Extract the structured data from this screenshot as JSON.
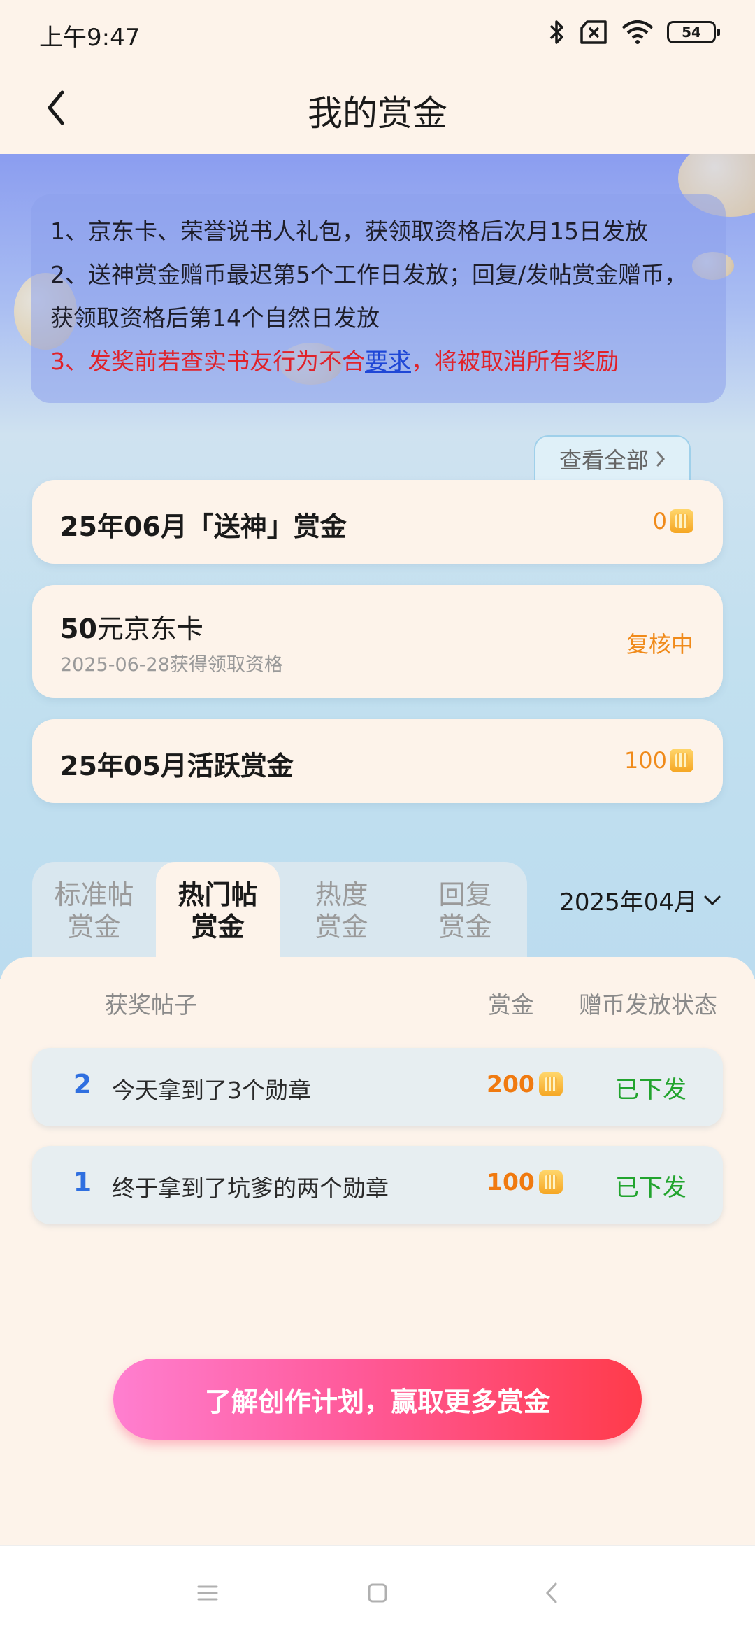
{
  "status_bar": {
    "time": "上午9:47",
    "battery": "54"
  },
  "header": {
    "title": "我的赏金"
  },
  "notice": {
    "line1": "1、京东卡、荣誉说书人礼包，获领取资格后次月15日发放",
    "line2": "2、送神赏金赠币最迟第5个工作日发放；回复/发帖赏金赠币，获领取资格后第14个自然日发放",
    "line3_prefix": "3、发奖前若查实书友行为不合",
    "line3_link": "要求",
    "line3_suffix": "，将被取消所有奖励"
  },
  "view_all": "查看全部",
  "rewards": [
    {
      "title": "25年06月「送神」赏金",
      "value": "0"
    },
    {
      "title_bold": "50",
      "title_rest": "元京东卡",
      "subtitle": "2025-06-28获得领取资格",
      "status": "复核中"
    },
    {
      "title": "25年05月活跃赏金",
      "value": "100"
    }
  ],
  "tabs": [
    {
      "line1": "标准帖",
      "line2": "赏金"
    },
    {
      "line1": "热门帖",
      "line2": "赏金"
    },
    {
      "line1": "热度",
      "line2": "赏金"
    },
    {
      "line1": "回复",
      "line2": "赏金"
    }
  ],
  "active_tab": 1,
  "month_selector": "2025年04月",
  "table": {
    "headers": {
      "post": "获奖帖子",
      "reward": "赏金",
      "status": "赠币发放状态"
    },
    "rows": [
      {
        "rank": "2",
        "post": "今天拿到了3个勋章",
        "amount": "200",
        "status": "已下发"
      },
      {
        "rank": "1",
        "post": "终于拿到了坑爹的两个勋章",
        "amount": "100",
        "status": "已下发"
      }
    ]
  },
  "cta": "了解创作计划，赢取更多赏金",
  "colors": {
    "accent_orange": "#f08a1a",
    "status_green": "#22a42e",
    "rank_blue": "#2f6fe0",
    "warning_red": "#e0222a"
  },
  "icons": [
    "back-chevron-icon",
    "bluetooth-icon",
    "sim-x-icon",
    "wifi-icon",
    "battery-icon",
    "coin-icon",
    "chevron-right-icon",
    "chevron-down-icon",
    "menu-icon",
    "home-icon",
    "back-icon"
  ]
}
